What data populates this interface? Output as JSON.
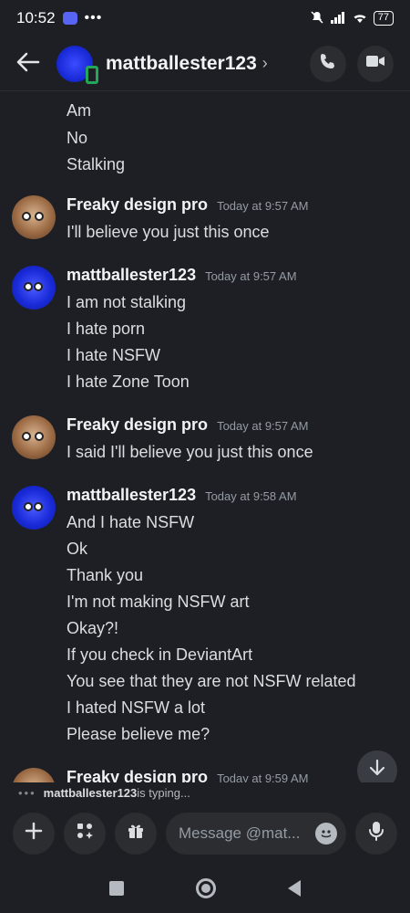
{
  "status_bar": {
    "time": "10:52",
    "dots": "•••",
    "battery": "77"
  },
  "header": {
    "title": "mattballester123",
    "chevron": "›"
  },
  "messages": {
    "continued_lines": [
      "Am",
      "No",
      "Stalking"
    ],
    "groups": [
      {
        "author": "Freaky design pro",
        "timestamp": "Today at 9:57 AM",
        "avatar": "monkey",
        "lines": [
          "I'll believe you just this once"
        ]
      },
      {
        "author": "mattballester123",
        "timestamp": "Today at 9:57 AM",
        "avatar": "blue",
        "lines": [
          "I am not stalking",
          "I hate porn",
          "I hate NSFW",
          "I hate Zone Toon"
        ]
      },
      {
        "author": "Freaky design pro",
        "timestamp": "Today at 9:57 AM",
        "avatar": "monkey",
        "lines": [
          "I said I'll believe you just this once"
        ]
      },
      {
        "author": "mattballester123",
        "timestamp": "Today at 9:58 AM",
        "avatar": "blue",
        "lines": [
          "And I hate NSFW",
          "Ok",
          "Thank you",
          "I'm not making NSFW art",
          "Okay?!",
          "If you check in DeviantArt",
          "You see that they are not NSFW related",
          "I hated NSFW a lot",
          "Please believe me?"
        ]
      },
      {
        "author": "Freaky design pro",
        "timestamp": "Today at 9:59 AM",
        "avatar": "monkey",
        "lines": []
      }
    ]
  },
  "typing": {
    "user": "mattballester123",
    "text": " is typing..."
  },
  "composer": {
    "placeholder": "Message @mat..."
  },
  "icons": {
    "back": "arrow-left-icon",
    "call": "phone-icon",
    "video": "video-camera-icon",
    "add": "plus-icon",
    "apps": "apps-icon",
    "gift": "gift-icon",
    "emoji": "emoji-icon",
    "mic": "microphone-icon",
    "scroll": "arrow-down-icon"
  }
}
